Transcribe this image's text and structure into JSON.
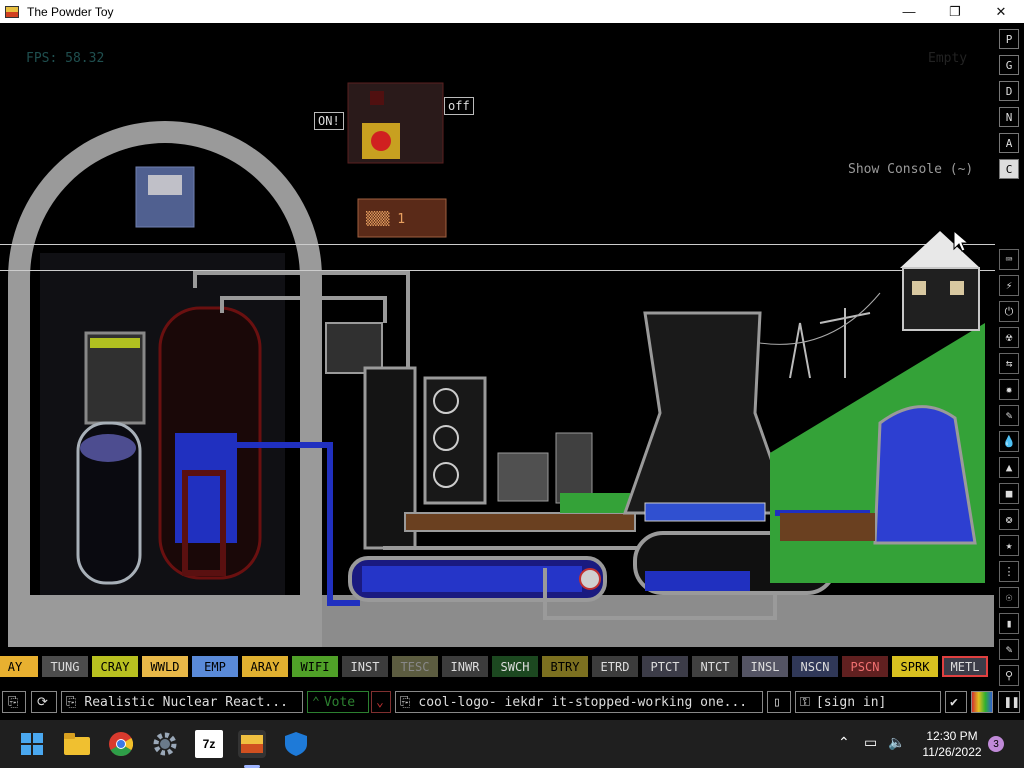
{
  "window": {
    "title": "The Powder Toy",
    "minimize": "—",
    "maximize": "❐",
    "close": "✕"
  },
  "hud": {
    "fps": "FPS: 58.32",
    "empty": "Empty",
    "console_hint": "Show Console (~)"
  },
  "switch": {
    "on": "ON!",
    "off": "off"
  },
  "right_menu": [
    "P",
    "G",
    "D",
    "N",
    "A",
    "C"
  ],
  "tools": [
    "⌨",
    "⚡",
    "⏻",
    "☢",
    "⇆",
    "✹",
    "✎",
    "💧",
    "▲",
    "■",
    "❂",
    "★",
    "⋮",
    "☉",
    "▮",
    "✎",
    "⚲"
  ],
  "elements": [
    {
      "label": "AY",
      "bg": "#e8b030",
      "fg": "#000"
    },
    {
      "label": "TUNG",
      "bg": "#4c4c4c",
      "fg": "#ddd"
    },
    {
      "label": "CRAY",
      "bg": "#b8c020",
      "fg": "#000"
    },
    {
      "label": "WWLD",
      "bg": "#e8b848",
      "fg": "#000"
    },
    {
      "label": "EMP",
      "bg": "#5a8ad8",
      "fg": "#000"
    },
    {
      "label": "ARAY",
      "bg": "#e0b030",
      "fg": "#000"
    },
    {
      "label": "WIFI",
      "bg": "#50a028",
      "fg": "#000"
    },
    {
      "label": "INST",
      "bg": "#3c3c3c",
      "fg": "#ddd"
    },
    {
      "label": "TESC",
      "bg": "#5c5c40",
      "fg": "#888"
    },
    {
      "label": "INWR",
      "bg": "#3c3c3c",
      "fg": "#ddd"
    },
    {
      "label": "SWCH",
      "bg": "#1c4820",
      "fg": "#ddd"
    },
    {
      "label": "BTRY",
      "bg": "#7c7020",
      "fg": "#000"
    },
    {
      "label": "ETRD",
      "bg": "#3c3c3c",
      "fg": "#ddd"
    },
    {
      "label": "PTCT",
      "bg": "#3c3c48",
      "fg": "#ddd"
    },
    {
      "label": "NTCT",
      "bg": "#404040",
      "fg": "#ddd"
    },
    {
      "label": "INSL",
      "bg": "#545464",
      "fg": "#ddd"
    },
    {
      "label": "NSCN",
      "bg": "#303858",
      "fg": "#ddd"
    },
    {
      "label": "PSCN",
      "bg": "#602020",
      "fg": "#f07070"
    },
    {
      "label": "SPRK",
      "bg": "#d8c020",
      "fg": "#000"
    },
    {
      "label": "METL",
      "bg": "#3c3c48",
      "fg": "#ddd"
    }
  ],
  "bottom_bar": {
    "save_title": "Realistic Nuclear React...",
    "vote": "Vote",
    "tags": "cool-logo- iekdr it-stopped-working one...",
    "sign_in": "[sign in]"
  },
  "taskbar": {
    "time": "12:30 PM",
    "date": "11/26/2022",
    "notifications": "3",
    "sevenzip": "7z"
  },
  "colors": {
    "accent": "#e04040",
    "grass": "#34a238",
    "water": "#2d3fd1",
    "steel": "#9a9a9a"
  }
}
